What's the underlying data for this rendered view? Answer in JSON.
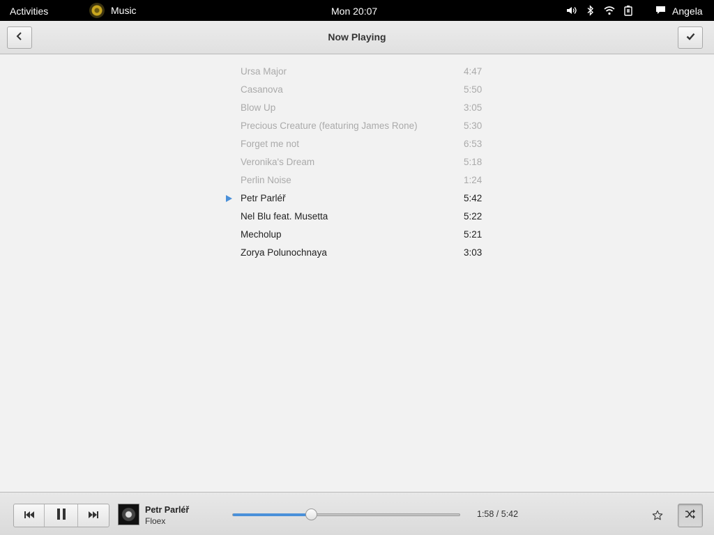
{
  "top_panel": {
    "activities": "Activities",
    "app_name": "Music",
    "app_icon": "music-app-icon",
    "clock": "Mon 20:07",
    "status_icons": [
      "volume-icon",
      "bluetooth-icon",
      "wifi-icon",
      "battery-icon"
    ],
    "chat_icon": "chat-icon",
    "user": "Angela"
  },
  "header": {
    "title": "Now Playing",
    "back_icon": "chevron-left-icon",
    "done_icon": "checkmark-icon"
  },
  "playlist": {
    "played": [
      {
        "title": "Ursa Major",
        "duration": "4:47"
      },
      {
        "title": "Casanova",
        "duration": "5:50"
      },
      {
        "title": "Blow Up",
        "duration": "3:05"
      },
      {
        "title": "Precious Creature (featuring James Rone)",
        "duration": "5:30"
      },
      {
        "title": "Forget me not",
        "duration": "6:53"
      },
      {
        "title": "Veronika's Dream",
        "duration": "5:18"
      },
      {
        "title": "Perlin Noise",
        "duration": "1:24"
      }
    ],
    "current": {
      "title": "Petr Parléř",
      "duration": "5:42"
    },
    "upcoming": [
      {
        "title": "Nel Blu feat. Musetta",
        "duration": "5:22"
      },
      {
        "title": "Mecholup",
        "duration": "5:21"
      },
      {
        "title": "Zorya Polunochnaya",
        "duration": "3:03"
      }
    ]
  },
  "player": {
    "track_title": "Petr Parléř",
    "artist": "Floex",
    "time_display": "1:58 / 5:42",
    "progress_fraction": 0.345,
    "controls": [
      "previous-icon",
      "pause-icon",
      "next-icon"
    ],
    "favorite_icon": "star-icon",
    "shuffle_icon": "shuffle-icon",
    "shuffle_active": true
  },
  "colors": {
    "accent": "#4a90d9",
    "played_text": "#aaaaaa",
    "panel_bg": "#000000"
  }
}
